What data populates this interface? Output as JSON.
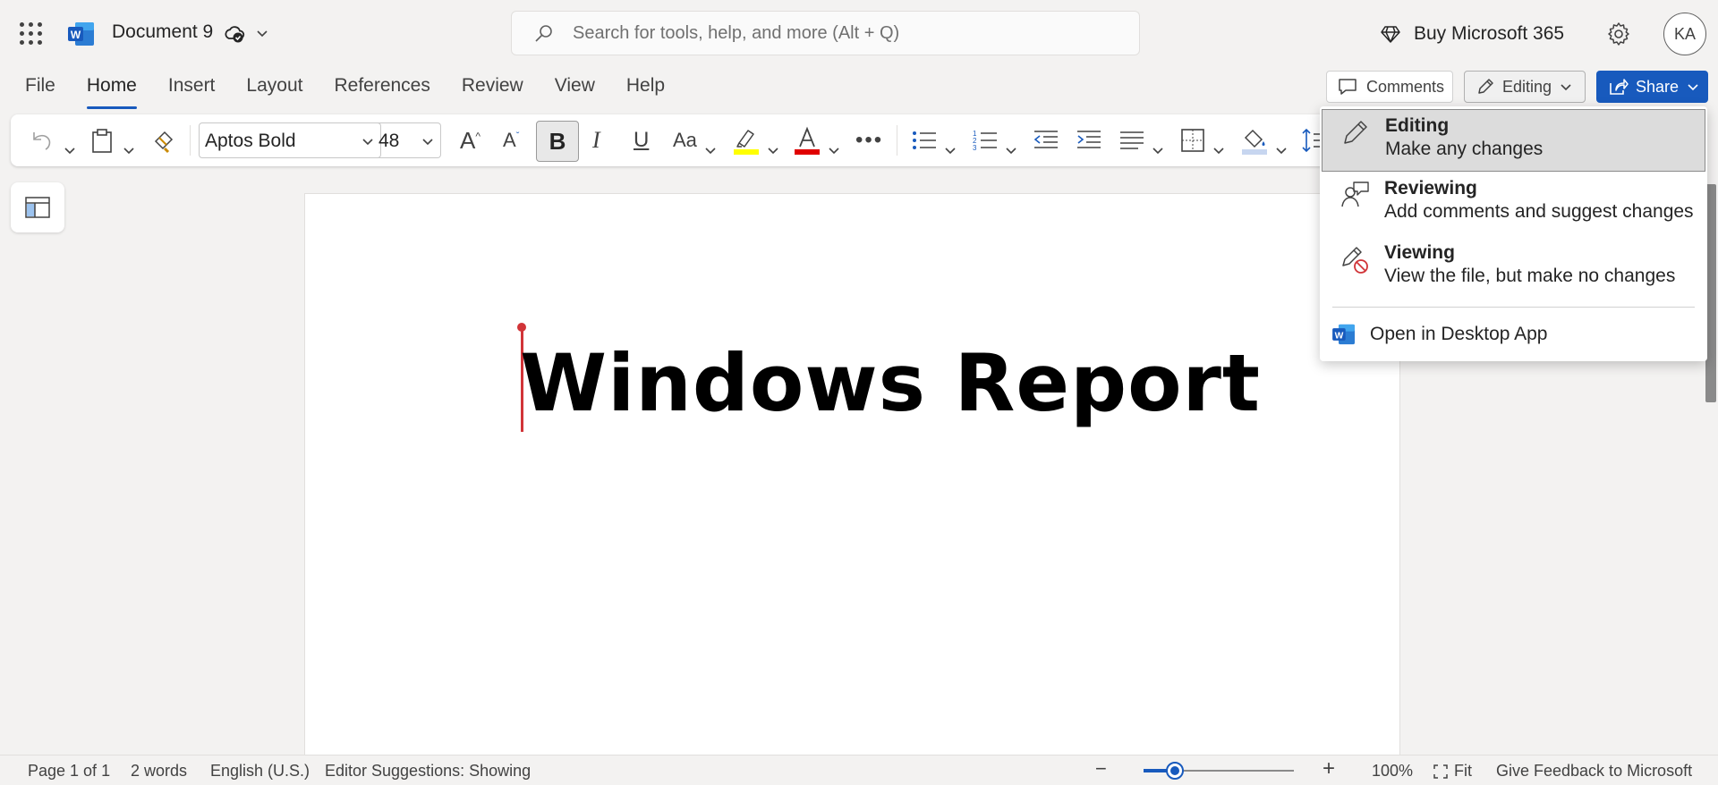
{
  "titlebar": {
    "doc_title": "Document 9",
    "search_placeholder": "Search for tools, help, and more (Alt + Q)",
    "buy_label": "Buy Microsoft 365",
    "avatar_initials": "KA"
  },
  "tabs": [
    "File",
    "Home",
    "Insert",
    "Layout",
    "References",
    "Review",
    "View",
    "Help"
  ],
  "active_tab": "Home",
  "actions": {
    "comments_label": "Comments",
    "editing_label": "Editing",
    "share_label": "Share"
  },
  "ribbon": {
    "font_name": "Aptos Bold",
    "font_size": "48",
    "bold_label": "B",
    "italic_label": "I",
    "underline_label": "U",
    "case_label": "Aa",
    "highlight_color": "#ffff00",
    "font_color": "#e00000"
  },
  "document": {
    "heading": "Windows Report"
  },
  "mode_menu": {
    "items": [
      {
        "title": "Editing",
        "subtitle": "Make any changes",
        "icon": "pencil-icon",
        "selected": true
      },
      {
        "title": "Reviewing",
        "subtitle": "Add comments and suggest changes",
        "icon": "reviewing-icon",
        "selected": false
      },
      {
        "title": "Viewing",
        "subtitle": "View the file, but make no changes",
        "icon": "viewing-icon",
        "selected": false
      }
    ],
    "open_desktop_label": "Open in Desktop App"
  },
  "statusbar": {
    "page": "Page 1 of 1",
    "words": "2 words",
    "language": "English (U.S.)",
    "editor": "Editor Suggestions: Showing",
    "zoom": "100%",
    "zoom_level": 0.21,
    "fit": "Fit",
    "feedback": "Give Feedback to Microsoft"
  },
  "colors": {
    "accent": "#185abd",
    "cursor": "#d13438"
  }
}
